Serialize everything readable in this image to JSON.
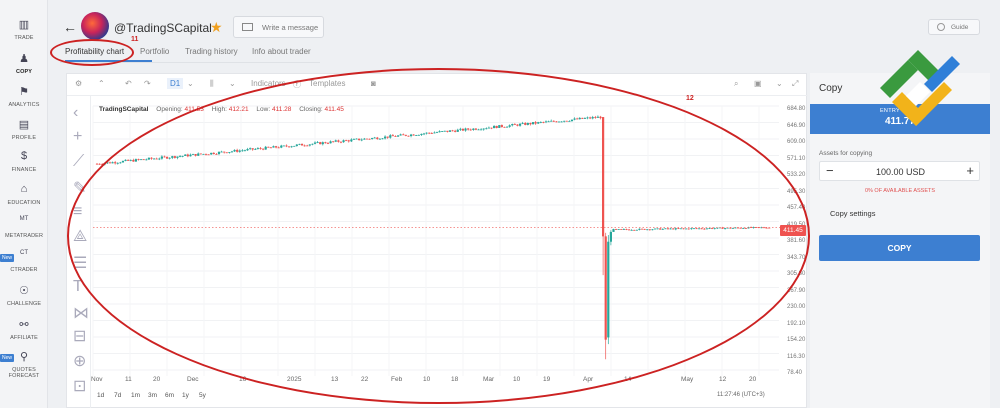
{
  "nav": {
    "items": [
      {
        "label": "TRADE",
        "icon": "chart-icon"
      },
      {
        "label": "COPY",
        "icon": "user-copy-icon",
        "active": true
      },
      {
        "label": "ANALYTICS",
        "icon": "graduation-icon"
      },
      {
        "label": "PROFILE",
        "icon": "id-card-icon"
      },
      {
        "label": "FINANCE",
        "icon": "dollar-icon"
      },
      {
        "label": "EDUCATION",
        "icon": "education-icon"
      },
      {
        "label": "METATRADER",
        "icon": "mt-icon"
      },
      {
        "label": "CTRADER",
        "icon": "ct-icon",
        "badge": "New"
      },
      {
        "label": "CHALLENGE",
        "icon": "challenge-icon"
      },
      {
        "label": "AFFILIATE",
        "icon": "handshake-icon"
      },
      {
        "label": "QUOTES FORECAST",
        "icon": "forecast-icon",
        "badge": "New"
      }
    ]
  },
  "header": {
    "trader_name": "@TradingSCapital",
    "message_placeholder": "Write a message",
    "guide_label": "Guide",
    "tabs": [
      "Profitability chart",
      "Portfolio",
      "Trading history",
      "Info about trader"
    ]
  },
  "chart_toolbar": {
    "timeframe": "D1",
    "indicators_label": "Indicators",
    "templates_label": "Templates"
  },
  "legend": {
    "symbol": "TradingSCapital",
    "opening_label": "Opening:",
    "opening": "411.53",
    "high_label": "High:",
    "high": "412.21",
    "low_label": "Low:",
    "low": "411.28",
    "closing_label": "Closing:",
    "closing": "411.45"
  },
  "price_axis": [
    "684.80",
    "646.90",
    "609.00",
    "571.10",
    "533.20",
    "495.30",
    "457.40",
    "419.50",
    "381.60",
    "343.70",
    "305.80",
    "267.90",
    "230.00",
    "192.10",
    "154.20",
    "116.30",
    "78.40"
  ],
  "current_price_tag": "411.45",
  "time_axis": [
    "Nov",
    "11",
    "20",
    "Dec",
    "16",
    "2025",
    "13",
    "22",
    "Feb",
    "10",
    "18",
    "Mar",
    "10",
    "19",
    "Apr",
    "14",
    "May",
    "12",
    "20"
  ],
  "range_buttons": [
    "1d",
    "7d",
    "1m",
    "3m",
    "6m",
    "1y",
    "5y"
  ],
  "clock": "11:27:46 (UTC+3)",
  "chart_data": {
    "type": "candlestick",
    "x_start": "Nov",
    "x_end": "May 20",
    "ylim": [
      78.4,
      684.8
    ],
    "phases": [
      {
        "from": "Nov",
        "to": "Apr 1",
        "trend": "rising",
        "start": 555,
        "end": 660
      },
      {
        "at": "Apr 2",
        "event": "crash",
        "low": 116,
        "high": 660
      },
      {
        "from": "Apr 3",
        "to": "May 20",
        "trend": "flat",
        "level": 411
      }
    ],
    "last": {
      "open": 411.53,
      "high": 412.21,
      "low": 411.28,
      "close": 411.45
    }
  },
  "copy_panel": {
    "title": "Copy",
    "entry_label": "ENTRY PRICE",
    "entry_value": "411.77",
    "assets_label": "Assets for copying",
    "amount": "100.00 USD",
    "available": "0% OF AVAILABLE ASSETS",
    "settings_label": "Copy settings",
    "copy_button": "COPY"
  },
  "annotations": {
    "tab_marker": "11",
    "chart_marker": "12"
  },
  "colors": {
    "accent": "#3d7fd1",
    "up": "#26a69a",
    "down": "#ef5350",
    "annotation": "#cc2222"
  }
}
